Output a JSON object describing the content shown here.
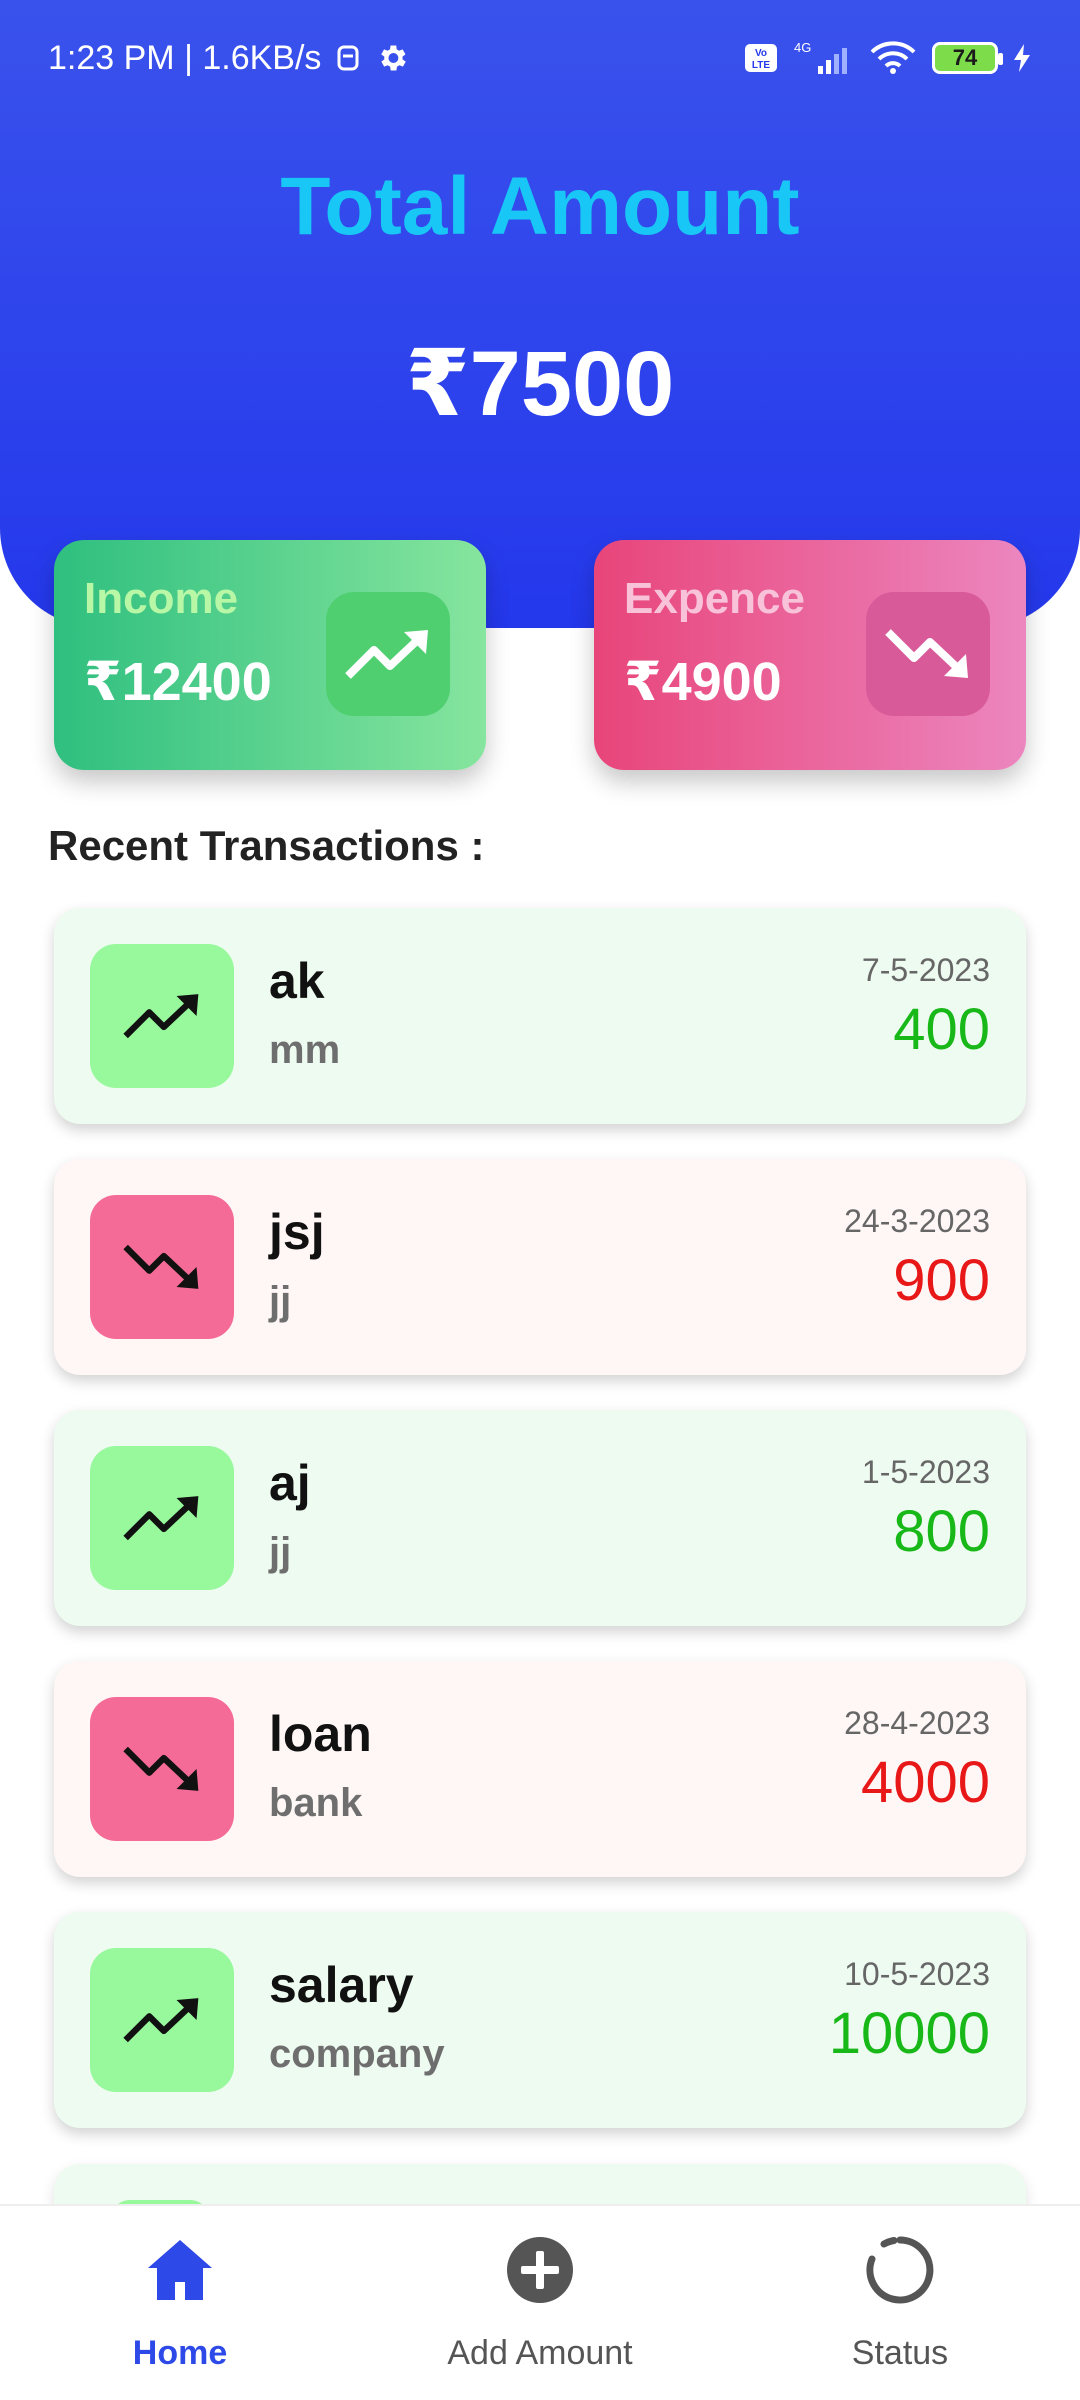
{
  "status_bar": {
    "left_text": "1:23 PM | 1.6KB/s",
    "network": "4G",
    "battery": "74"
  },
  "header": {
    "title": "Total Amount",
    "total": "₹7500"
  },
  "summary": {
    "income_label": "Income",
    "income_value": "₹12400",
    "expense_label": "Expence",
    "expense_value": "₹4900"
  },
  "section_title": "Recent Transactions :",
  "transactions": [
    {
      "name": "ak",
      "desc": "mm",
      "date": "7-5-2023",
      "amount": "400",
      "type": "income"
    },
    {
      "name": "jsj",
      "desc": "jj",
      "date": "24-3-2023",
      "amount": "900",
      "type": "expense"
    },
    {
      "name": "aj",
      "desc": "jj",
      "date": "1-5-2023",
      "amount": "800",
      "type": "income"
    },
    {
      "name": "loan",
      "desc": "bank",
      "date": "28-4-2023",
      "amount": "4000",
      "type": "expense"
    },
    {
      "name": "salary",
      "desc": "company",
      "date": "10-5-2023",
      "amount": "10000",
      "type": "income"
    }
  ],
  "nav": [
    {
      "label": "Home",
      "icon": "home-icon",
      "active": true
    },
    {
      "label": "Add Amount",
      "icon": "add-circle-icon",
      "active": false
    },
    {
      "label": "Status",
      "icon": "status-ring-icon",
      "active": false
    }
  ],
  "colors": {
    "header": "#2438ec",
    "title_accent": "#18c7f5",
    "income_green": "#18b818",
    "expense_red": "#e81818",
    "nav_active": "#2d49e8"
  }
}
